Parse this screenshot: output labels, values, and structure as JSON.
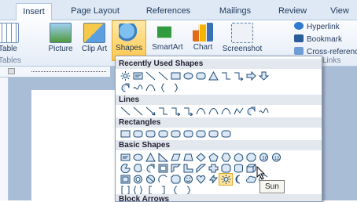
{
  "tabs": [
    "Insert",
    "Page Layout",
    "References",
    "Mailings",
    "Review",
    "View"
  ],
  "ribbon": {
    "table_label": "Table",
    "picture_label": "Picture",
    "clip_art_label": "Clip Art",
    "shapes_label": "Shapes",
    "smartart_label": "SmartArt",
    "chart_label": "Chart",
    "screenshot_label": "Screenshot",
    "hyperlink_label": "Hyperlink",
    "bookmark_label": "Bookmark",
    "cross_reference_label": "Cross-reference",
    "group_tables": "Tables",
    "group_links": "Links"
  },
  "menu": {
    "section_recent": "Recently Used Shapes",
    "section_lines": "Lines",
    "section_rectangles": "Rectangles",
    "section_basic": "Basic Shapes",
    "section_block_arrows": "Block Arrows"
  },
  "tooltip": "Sun",
  "colors": {
    "accent": "#ffc84f",
    "ribbon_bg": "#dfe9f5",
    "shape_stroke": "#1f4e79"
  }
}
